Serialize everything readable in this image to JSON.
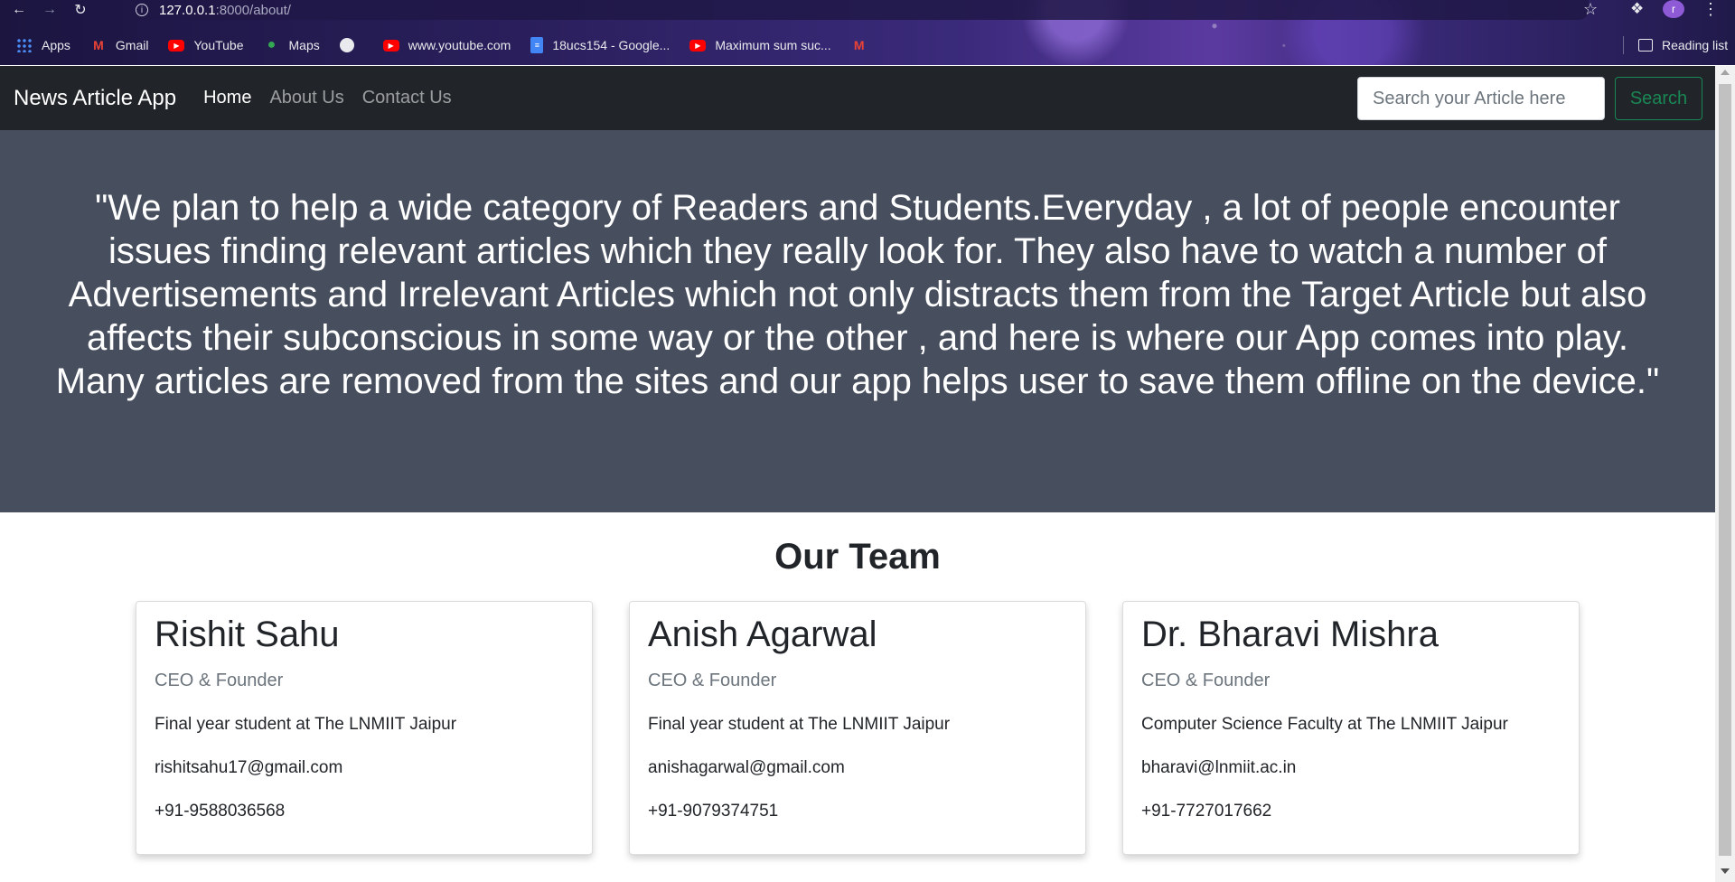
{
  "browser": {
    "url_host": "127.0.0.1",
    "url_path": ":8000/about/",
    "profile_initial": "r",
    "bookmarks": [
      {
        "label": "Apps",
        "icon": "apps-grid-icon"
      },
      {
        "label": "Gmail",
        "icon": "gmail-icon"
      },
      {
        "label": "YouTube",
        "icon": "youtube-icon"
      },
      {
        "label": "Maps",
        "icon": "maps-pin-icon"
      },
      {
        "label": "",
        "icon": "globe-icon"
      },
      {
        "label": "www.youtube.com",
        "icon": "youtube-icon"
      },
      {
        "label": "18ucs154 - Google...",
        "icon": "google-docs-icon"
      },
      {
        "label": "Maximum sum suc...",
        "icon": "youtube-icon"
      },
      {
        "label": "",
        "icon": "gmail-icon"
      }
    ],
    "reading_list": "Reading list"
  },
  "navbar": {
    "brand": "News Article App",
    "links": [
      "Home",
      "About Us",
      "Contact Us"
    ],
    "search_placeholder": "Search your Article here",
    "search_button": "Search"
  },
  "hero": {
    "quote": "\"We plan to help a wide category of Readers and Students.Everyday , a lot of people encounter issues finding relevant articles which they really look for. They also have to watch a number of Advertisements and Irrelevant Articles which not only distracts them from the Target Article but also affects their subconscious in some way or the other , and here is where our App comes into play. Many articles are removed from the sites and our app helps user to save them offline on the device.\""
  },
  "team": {
    "title": "Our Team",
    "members": [
      {
        "name": "Rishit Sahu",
        "role": "CEO & Founder",
        "desc": "Final year student at The LNMIIT Jaipur",
        "email": "rishitsahu17@gmail.com",
        "phone": "+91-9588036568"
      },
      {
        "name": "Anish Agarwal",
        "role": "CEO & Founder",
        "desc": "Final year student at The LNMIIT Jaipur",
        "email": "anishagarwal@gmail.com",
        "phone": "+91-9079374751"
      },
      {
        "name": "Dr. Bharavi Mishra",
        "role": "CEO & Founder",
        "desc": "Computer Science Faculty at The LNMIIT Jaipur",
        "email": "bharavi@lnmiit.ac.in",
        "phone": "+91-7727017662"
      }
    ]
  },
  "colors": {
    "navbar_bg": "#212529",
    "hero_bg": "#474e5d",
    "search_button": "#198754"
  }
}
